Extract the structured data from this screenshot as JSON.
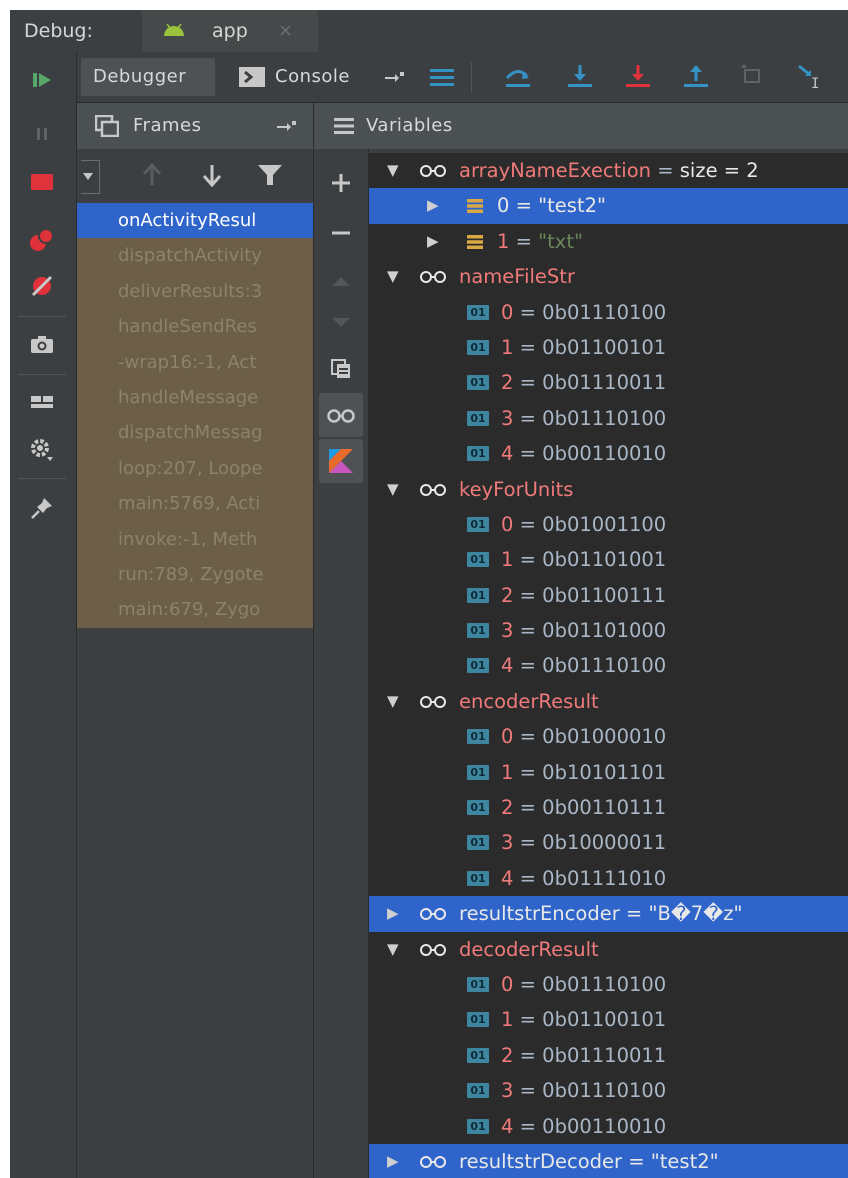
{
  "title_bar": {
    "debug_label": "Debug:",
    "app_tab_label": "app",
    "app_tab_close": "×"
  },
  "tabs": {
    "debugger_label": "Debugger",
    "console_label": "Console"
  },
  "frames": {
    "title": "Frames",
    "items": [
      "onActivityResul",
      "dispatchActivity",
      "deliverResults:3",
      "handleSendRes",
      "-wrap16:-1, Act",
      "handleMessage",
      "dispatchMessag",
      "loop:207, Loopе",
      "main:5769, Acti",
      "invoke:-1, Meth",
      "run:789, Zygote",
      "main:679, Zygo"
    ],
    "selected_index": 0
  },
  "variables": {
    "title": "Variables",
    "rows": [
      {
        "level": 0,
        "expand": "expanded",
        "kind": "spectacles",
        "name": "arrayNameExection",
        "sep": " = ",
        "value": " size = 2",
        "name_color": "red",
        "value_color": "white",
        "selected": false
      },
      {
        "level": 1,
        "expand": "collapsed",
        "kind": "bars",
        "name": "0",
        "sep": " = ",
        "value": "\"test2\"",
        "name_color": "white",
        "value_color": "white",
        "selected": true
      },
      {
        "level": 1,
        "expand": "collapsed",
        "kind": "bars",
        "name": "1",
        "sep": " = ",
        "value": "\"txt\"",
        "name_color": "red",
        "value_color": "green",
        "selected": false
      },
      {
        "level": 0,
        "expand": "expanded",
        "kind": "spectacles",
        "name": "nameFileStr",
        "sep": "",
        "value": "",
        "name_color": "red",
        "value_color": "white",
        "selected": false
      },
      {
        "level": 2,
        "expand": "none",
        "kind": "binary",
        "name": "0",
        "sep": " = ",
        "value": "0b01110100",
        "name_color": "red",
        "value_color": "blue",
        "selected": false
      },
      {
        "level": 2,
        "expand": "none",
        "kind": "binary",
        "name": "1",
        "sep": " = ",
        "value": "0b01100101",
        "name_color": "red",
        "value_color": "blue",
        "selected": false
      },
      {
        "level": 2,
        "expand": "none",
        "kind": "binary",
        "name": "2",
        "sep": " = ",
        "value": "0b01110011",
        "name_color": "red",
        "value_color": "blue",
        "selected": false
      },
      {
        "level": 2,
        "expand": "none",
        "kind": "binary",
        "name": "3",
        "sep": " = ",
        "value": "0b01110100",
        "name_color": "red",
        "value_color": "blue",
        "selected": false
      },
      {
        "level": 2,
        "expand": "none",
        "kind": "binary",
        "name": "4",
        "sep": " = ",
        "value": "0b00110010",
        "name_color": "red",
        "value_color": "blue",
        "selected": false
      },
      {
        "level": 0,
        "expand": "expanded",
        "kind": "spectacles",
        "name": "keyForUnits",
        "sep": "",
        "value": "",
        "name_color": "red",
        "value_color": "white",
        "selected": false
      },
      {
        "level": 2,
        "expand": "none",
        "kind": "binary",
        "name": "0",
        "sep": " = ",
        "value": "0b01001100",
        "name_color": "red",
        "value_color": "blue",
        "selected": false
      },
      {
        "level": 2,
        "expand": "none",
        "kind": "binary",
        "name": "1",
        "sep": " = ",
        "value": "0b01101001",
        "name_color": "red",
        "value_color": "blue",
        "selected": false
      },
      {
        "level": 2,
        "expand": "none",
        "kind": "binary",
        "name": "2",
        "sep": " = ",
        "value": "0b01100111",
        "name_color": "red",
        "value_color": "blue",
        "selected": false
      },
      {
        "level": 2,
        "expand": "none",
        "kind": "binary",
        "name": "3",
        "sep": " = ",
        "value": "0b01101000",
        "name_color": "red",
        "value_color": "blue",
        "selected": false
      },
      {
        "level": 2,
        "expand": "none",
        "kind": "binary",
        "name": "4",
        "sep": " = ",
        "value": "0b01110100",
        "name_color": "red",
        "value_color": "blue",
        "selected": false
      },
      {
        "level": 0,
        "expand": "expanded",
        "kind": "spectacles",
        "name": "encoderResult",
        "sep": "",
        "value": "",
        "name_color": "red",
        "value_color": "white",
        "selected": false
      },
      {
        "level": 2,
        "expand": "none",
        "kind": "binary",
        "name": "0",
        "sep": " = ",
        "value": "0b01000010",
        "name_color": "red",
        "value_color": "blue",
        "selected": false
      },
      {
        "level": 2,
        "expand": "none",
        "kind": "binary",
        "name": "1",
        "sep": " = ",
        "value": "0b10101101",
        "name_color": "red",
        "value_color": "blue",
        "selected": false
      },
      {
        "level": 2,
        "expand": "none",
        "kind": "binary",
        "name": "2",
        "sep": " = ",
        "value": "0b00110111",
        "name_color": "red",
        "value_color": "blue",
        "selected": false
      },
      {
        "level": 2,
        "expand": "none",
        "kind": "binary",
        "name": "3",
        "sep": " = ",
        "value": "0b10000011",
        "name_color": "red",
        "value_color": "blue",
        "selected": false
      },
      {
        "level": 2,
        "expand": "none",
        "kind": "binary",
        "name": "4",
        "sep": " = ",
        "value": "0b01111010",
        "name_color": "red",
        "value_color": "blue",
        "selected": false
      },
      {
        "level": 0,
        "expand": "collapsed",
        "kind": "spectacles",
        "name": "resultstrEncoder",
        "sep": " = ",
        "value": "\"B�7�z\"",
        "name_color": "white",
        "value_color": "white",
        "selected": true
      },
      {
        "level": 0,
        "expand": "expanded",
        "kind": "spectacles",
        "name": "decoderResult",
        "sep": "",
        "value": "",
        "name_color": "red",
        "value_color": "white",
        "selected": false
      },
      {
        "level": 2,
        "expand": "none",
        "kind": "binary",
        "name": "0",
        "sep": " = ",
        "value": "0b01110100",
        "name_color": "red",
        "value_color": "blue",
        "selected": false
      },
      {
        "level": 2,
        "expand": "none",
        "kind": "binary",
        "name": "1",
        "sep": " = ",
        "value": "0b01100101",
        "name_color": "red",
        "value_color": "blue",
        "selected": false
      },
      {
        "level": 2,
        "expand": "none",
        "kind": "binary",
        "name": "2",
        "sep": " = ",
        "value": "0b01110011",
        "name_color": "red",
        "value_color": "blue",
        "selected": false
      },
      {
        "level": 2,
        "expand": "none",
        "kind": "binary",
        "name": "3",
        "sep": " = ",
        "value": "0b01110100",
        "name_color": "red",
        "value_color": "blue",
        "selected": false
      },
      {
        "level": 2,
        "expand": "none",
        "kind": "binary",
        "name": "4",
        "sep": " = ",
        "value": "0b00110010",
        "name_color": "red",
        "value_color": "blue",
        "selected": false
      },
      {
        "level": 0,
        "expand": "collapsed",
        "kind": "spectacles",
        "name": "resultstrDecoder",
        "sep": " = ",
        "value": "\"test2\"",
        "name_color": "white",
        "value_color": "white",
        "selected": true
      }
    ]
  },
  "icons": {
    "left_toolbar": [
      "resume-icon",
      "pause-icon",
      "stop-icon",
      "view-breakpoints-icon",
      "mute-breakpoints-icon",
      "camera-icon",
      "layout-icon",
      "settings-icon",
      "pin-icon"
    ],
    "tab_toolbar": [
      "show-execution-point-icon",
      "step-over-icon",
      "step-into-icon",
      "force-step-into-icon",
      "step-out-icon",
      "drop-frame-icon",
      "run-to-cursor-icon"
    ],
    "frames_toolbar": [
      "dropdown-icon",
      "up-arrow-icon",
      "down-arrow-icon",
      "filter-icon"
    ],
    "mid_toolbar": [
      "new-watch-icon",
      "remove-watch-icon",
      "up-icon",
      "down-icon",
      "copy-icon",
      "show-watches-icon",
      "kotlin-icon"
    ]
  },
  "colors": {
    "background": "#3c3f41",
    "tree_background": "#2b2b2b",
    "selection": "#2f65ca",
    "frame_row": "#6c5e48",
    "name_red": "#f07a7a",
    "value_green": "#6a8759",
    "binary_badge": "#3e86a0"
  }
}
